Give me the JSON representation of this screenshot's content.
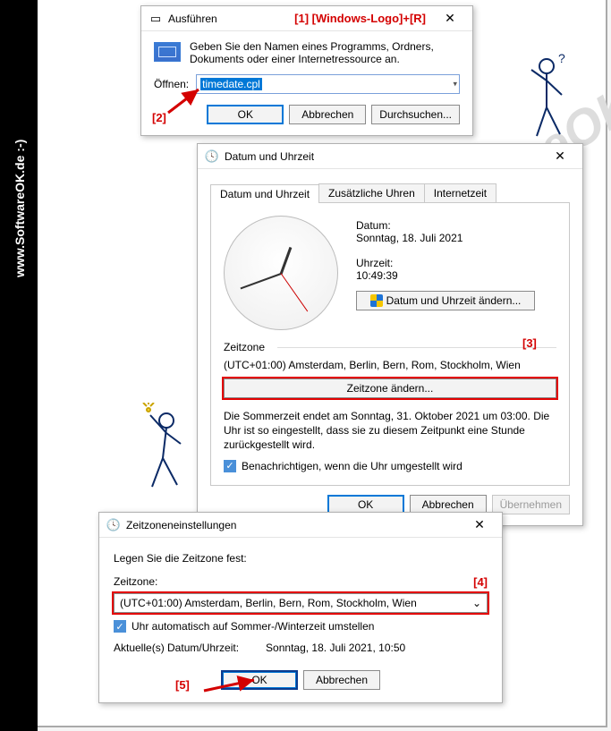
{
  "sidebar": {
    "label": "www.SoftwareOK.de :-)"
  },
  "watermark": "SoftwareOK.de",
  "annotations": {
    "a1": "[1]  [Windows-Logo]+[R]",
    "a2": "[2]",
    "a3": "[3]",
    "a4": "[4]",
    "a5": "[5]"
  },
  "run": {
    "title": "Ausführen",
    "description": "Geben Sie den Namen eines Programms, Ordners, Dokuments oder einer Internetressource an.",
    "open_label": "Öffnen:",
    "open_value": "timedate.cpl",
    "ok": "OK",
    "cancel": "Abbrechen",
    "browse": "Durchsuchen..."
  },
  "dt": {
    "title": "Datum und Uhrzeit",
    "tab1": "Datum und Uhrzeit",
    "tab2": "Zusätzliche Uhren",
    "tab3": "Internetzeit",
    "date_label": "Datum:",
    "date_value": "Sonntag, 18. Juli 2021",
    "time_label": "Uhrzeit:",
    "time_value": "10:49:39",
    "change_dt": "Datum und Uhrzeit ändern...",
    "tz_group": "Zeitzone",
    "tz_value": "(UTC+01:00) Amsterdam, Berlin, Bern, Rom, Stockholm, Wien",
    "change_tz": "Zeitzone ändern...",
    "dst_text": "Die Sommerzeit endet am Sonntag, 31. Oktober 2021 um 03:00. Die Uhr ist so eingestellt, dass sie zu diesem Zeitpunkt eine Stunde zurückgestellt wird.",
    "notify_label": "Benachrichtigen, wenn die Uhr umgestellt wird",
    "ok": "OK",
    "cancel": "Abbrechen",
    "apply": "Übernehmen"
  },
  "tz": {
    "title": "Zeitzoneneinstellungen",
    "prompt": "Legen Sie die Zeitzone fest:",
    "label": "Zeitzone:",
    "value": "(UTC+01:00) Amsterdam, Berlin, Bern, Rom, Stockholm, Wien",
    "auto_dst": "Uhr automatisch auf Sommer-/Winterzeit umstellen",
    "current_label": "Aktuelle(s) Datum/Uhrzeit:",
    "current_value": "Sonntag, 18. Juli 2021, 10:50",
    "ok": "OK",
    "cancel": "Abbrechen"
  }
}
